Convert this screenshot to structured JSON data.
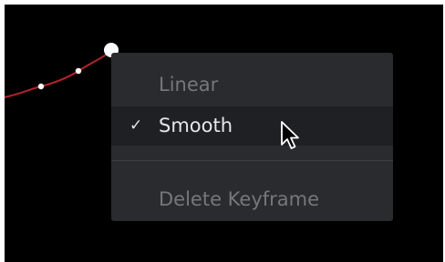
{
  "curve_editor": {
    "curve_color": "#b3232c",
    "point_color": "#ffffff"
  },
  "context_menu": {
    "items": [
      {
        "label": "Linear",
        "checked": false,
        "highlighted": false
      },
      {
        "label": "Smooth",
        "checked": true,
        "highlighted": true,
        "check_glyph": "✓"
      },
      {
        "label": "Delete Keyframe",
        "checked": false,
        "highlighted": false
      }
    ]
  },
  "cursor": {
    "icon": "arrow-pointer-icon"
  }
}
